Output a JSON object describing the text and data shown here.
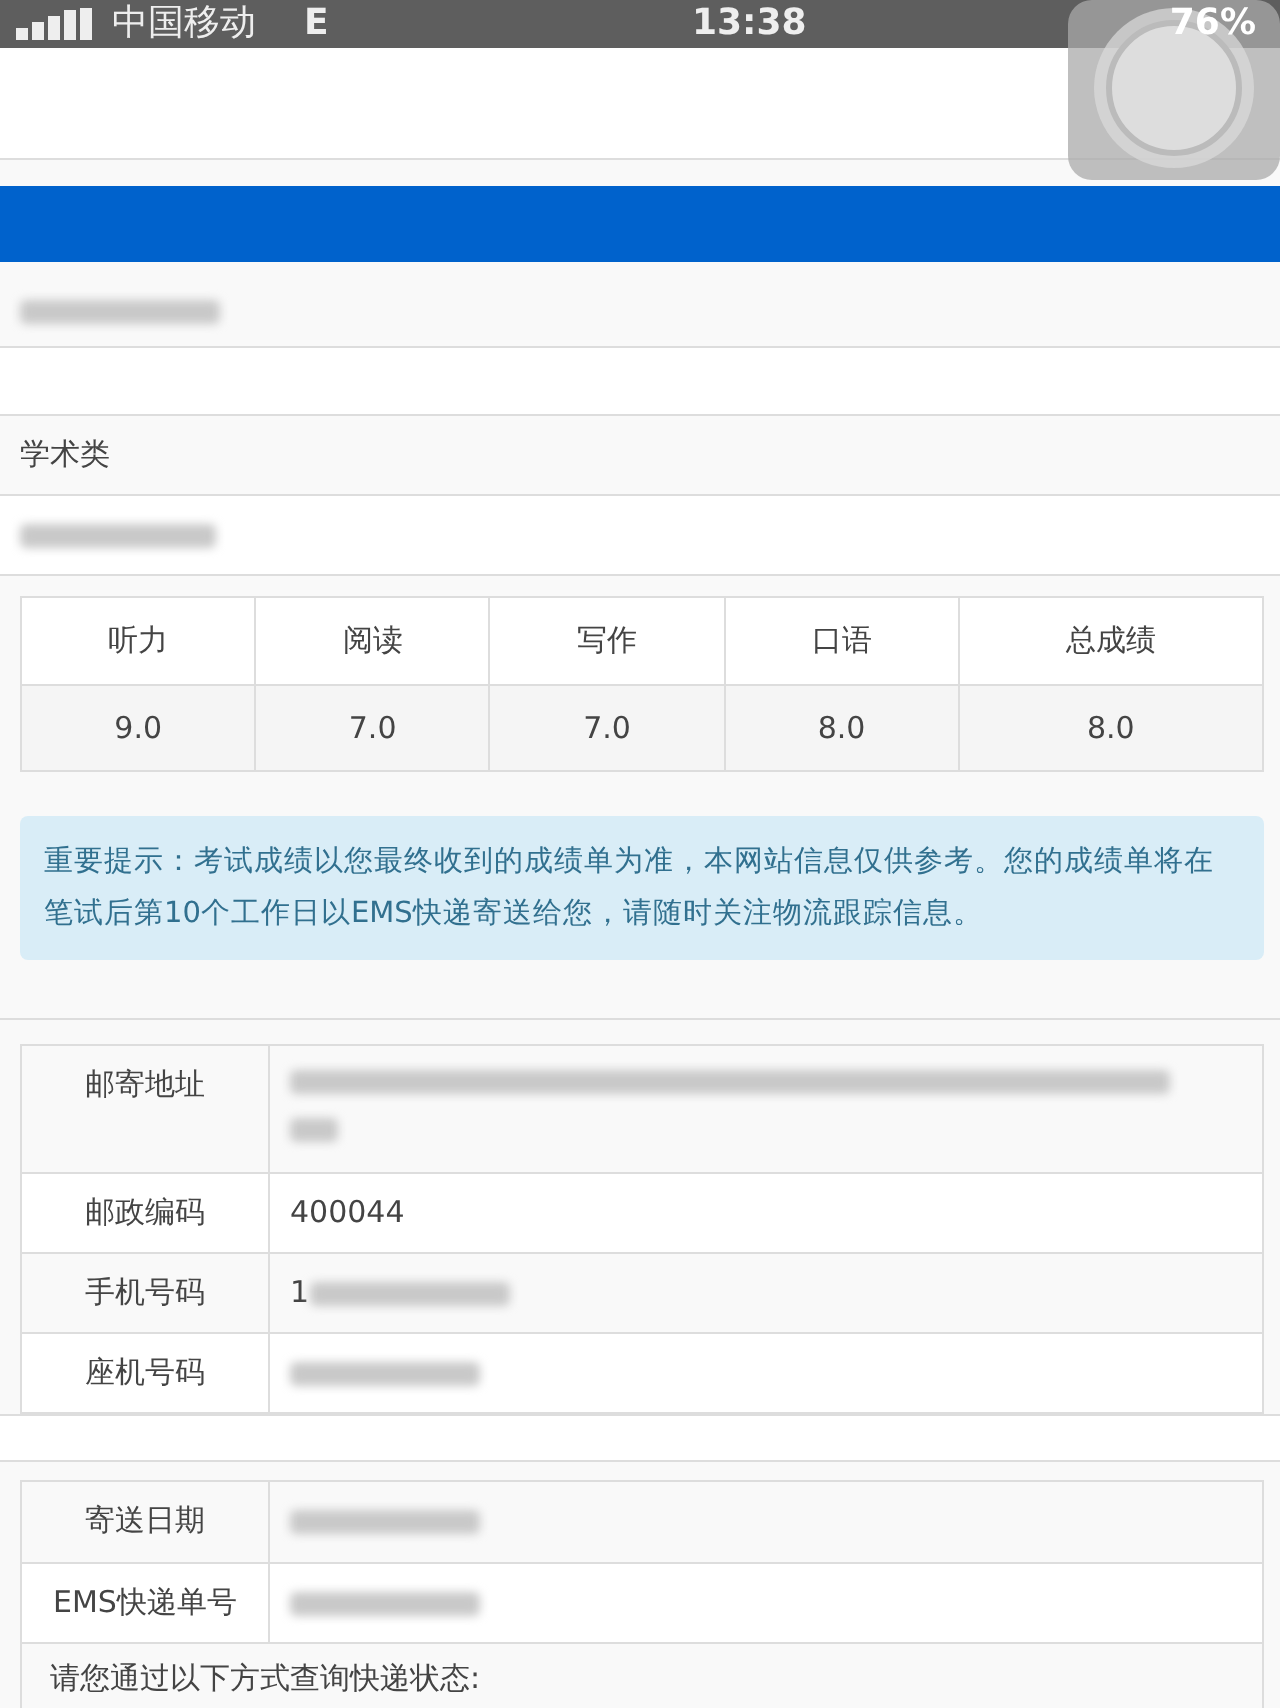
{
  "status_bar": {
    "carrier": "中国移动",
    "network": "E",
    "time": "13:38",
    "battery": "76%"
  },
  "contact_line": {
    "redacted": true
  },
  "exam_type": "学术类",
  "candidate_line": {
    "redacted": true
  },
  "scores": {
    "columns": [
      "听力",
      "阅读",
      "写作",
      "口语",
      "总成绩"
    ],
    "values": [
      "9.0",
      "7.0",
      "7.0",
      "8.0",
      "8.0"
    ]
  },
  "notice": "重要提示：考试成绩以您最终收到的成绩单为准，本网站信息仅供参考。您的成绩单将在笔试后第10个工作日以EMS快递寄送给您，请随时关注物流跟踪信息。",
  "address_table": [
    {
      "label": "邮寄地址",
      "kind": "multiline",
      "redacted": true
    },
    {
      "label": "邮政编码",
      "value": "400044",
      "redacted": false
    },
    {
      "label": "手机号码",
      "value": "1",
      "redacted": true
    },
    {
      "label": "座机号码",
      "redacted": true
    }
  ],
  "delivery_table": [
    {
      "label": "寄送日期",
      "redacted": true
    },
    {
      "label": "EMS快递单号",
      "redacted": true
    }
  ],
  "query_hint": "请您通过以下方式查询快递状态:"
}
